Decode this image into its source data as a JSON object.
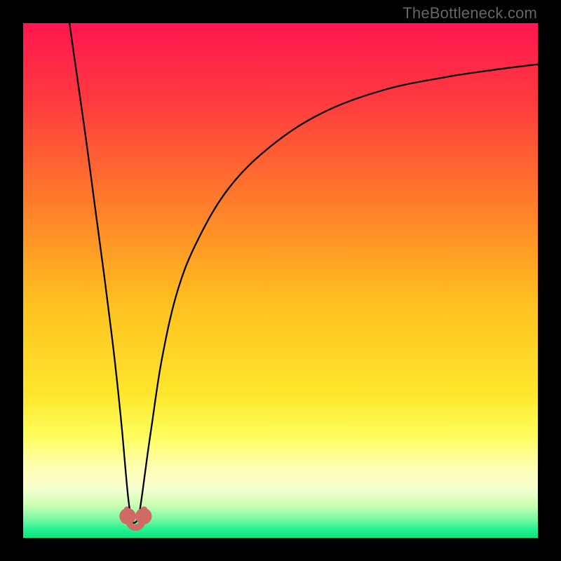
{
  "watermark": "TheBottleneck.com",
  "chart_data": {
    "type": "line",
    "title": "",
    "xlabel": "",
    "ylabel": "",
    "xlim": [
      0,
      100
    ],
    "ylim": [
      0,
      100
    ],
    "grid": false,
    "legend": false,
    "background_gradient": {
      "stops": [
        {
          "offset": 0.0,
          "color": "#ff1650"
        },
        {
          "offset": 0.15,
          "color": "#ff3a3f"
        },
        {
          "offset": 0.35,
          "color": "#ff7d2a"
        },
        {
          "offset": 0.55,
          "color": "#ffc21f"
        },
        {
          "offset": 0.72,
          "color": "#ffe62d"
        },
        {
          "offset": 0.8,
          "color": "#fffd5a"
        },
        {
          "offset": 0.86,
          "color": "#ffffb0"
        },
        {
          "offset": 0.905,
          "color": "#f6ffd2"
        },
        {
          "offset": 0.938,
          "color": "#c7ffb3"
        },
        {
          "offset": 0.965,
          "color": "#74f9a2"
        },
        {
          "offset": 0.985,
          "color": "#1ff08e"
        },
        {
          "offset": 1.0,
          "color": "#06e783"
        }
      ]
    },
    "series": [
      {
        "name": "bottleneck-curve",
        "stroke": "#000000",
        "stroke_width": 2.3,
        "x": [
          9.0,
          10.0,
          12.0,
          14.0,
          16.0,
          17.5,
          18.5,
          19.3,
          20.0,
          20.5,
          21.0,
          21.4,
          21.8,
          22.2,
          22.6,
          23.2,
          24.0,
          25.0,
          27.0,
          30.0,
          34.0,
          40.0,
          48.0,
          58.0,
          70.0,
          82.0,
          92.0,
          100.0
        ],
        "values": [
          100.0,
          93.0,
          79.0,
          64.0,
          49.0,
          37.0,
          28.0,
          20.0,
          12.0,
          7.0,
          4.0,
          3.0,
          3.0,
          3.5,
          5.0,
          9.0,
          15.0,
          22.0,
          35.0,
          48.0,
          58.0,
          68.0,
          76.0,
          82.5,
          87.0,
          89.5,
          91.0,
          92.0
        ]
      }
    ],
    "markers": [
      {
        "name": "left-dot",
        "x": 20.3,
        "y": 4.2,
        "r": 1.6,
        "fill": "#cf6a65"
      },
      {
        "name": "right-dot",
        "x": 23.4,
        "y": 4.2,
        "r": 1.6,
        "fill": "#cf6a65"
      }
    ],
    "bottom_band": {
      "name": "trough-band",
      "x0": 20.2,
      "x1": 23.5,
      "y0": 2.0,
      "y1": 5.5,
      "stroke": "#cf6a65",
      "stroke_width": 9
    }
  }
}
